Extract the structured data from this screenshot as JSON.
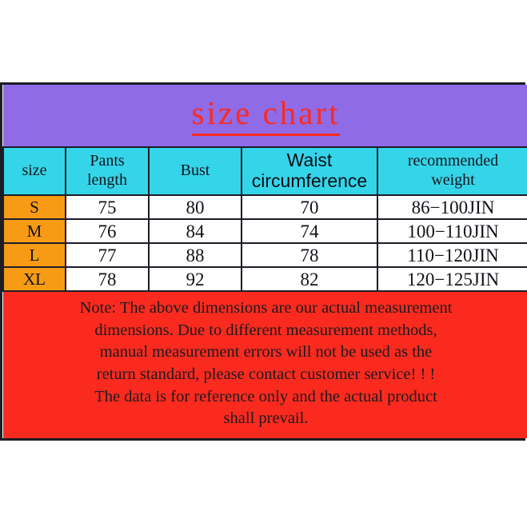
{
  "chart_data": {
    "type": "table",
    "title": "size chart",
    "columns": [
      "size",
      "Pants\nlength",
      "Bust",
      "Waist\ncircumference",
      "recommended\nweight"
    ],
    "rows": [
      {
        "size": "S",
        "pants_length": "75",
        "bust": "80",
        "waist_circumference": "70",
        "recommended_weight": "86−100JIN"
      },
      {
        "size": "M",
        "pants_length": "76",
        "bust": "84",
        "waist_circumference": "74",
        "recommended_weight": "100−110JIN"
      },
      {
        "size": "L",
        "pants_length": "77",
        "bust": "88",
        "waist_circumference": "78",
        "recommended_weight": "110−120JIN"
      },
      {
        "size": "XL",
        "pants_length": "78",
        "bust": "92",
        "waist_circumference": "82",
        "recommended_weight": "120−125JIN"
      }
    ],
    "note": "Note: The above dimensions are our actual measurement dimensions. Due to different measurement methods, manual measurement errors will not be used as the return standard, please contact customer service! ! ! The data is for reference only and the actual product shall prevail."
  },
  "title": {
    "text": "size chart"
  },
  "header": {
    "size": "size",
    "pants_length_line1": "Pants",
    "pants_length_line2": "length",
    "bust": "Bust",
    "waist_line1": "Waist",
    "waist_line2": "circumference",
    "weight_line1": "recommended",
    "weight_line2": "weight"
  },
  "rows": [
    {
      "size": "S",
      "pants_length": "75",
      "bust": "80",
      "waist": "70",
      "weight": "86−100JIN"
    },
    {
      "size": "M",
      "pants_length": "76",
      "bust": "84",
      "waist": "74",
      "weight": "100−110JIN"
    },
    {
      "size": "L",
      "pants_length": "77",
      "bust": "88",
      "waist": "78",
      "weight": "110−120JIN"
    },
    {
      "size": "XL",
      "pants_length": "78",
      "bust": "92",
      "waist": "82",
      "weight": "120−125JIN"
    }
  ],
  "note": {
    "text": "Note: The above dimensions are our actual measurement\ndimensions. Due to different measurement methods,\nmanual measurement errors will not be used as the\nreturn standard, please contact customer service! ! !\nThe data is for reference only and the actual product\nshall prevail."
  },
  "colors": {
    "title_background": "#8F6BE8",
    "title_text": "#FB2A1F",
    "header_background": "#34D5E9",
    "size_column_background": "#F89B14",
    "note_background": "#FB2A1F",
    "cell_background": "#FFFFFF",
    "border": "#1C1C26",
    "text": "#111118"
  }
}
